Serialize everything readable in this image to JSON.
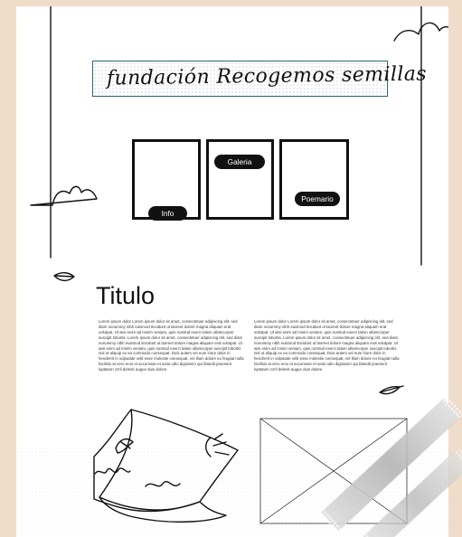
{
  "header": {
    "title": "fundación Recogemos semillas"
  },
  "nav": {
    "info_label": "Info",
    "gallery_label": "Galeria",
    "poem_label": "Poemario"
  },
  "content": {
    "section_title": "Titulo",
    "paragraph_left": "Lorem ipsum dolor Lorem ipsum dolor sit amet, consectetuer adipiscing elit, sed diam nonummy nibh euismod tincidunt ut laoreet dolore magna aliquam erat volutpat. Ut wisi enim ad minim veniam, quis nostrud exerci tation ullamcorper suscipit lobortis. Lorem ipsum dolor sit amet, consectetuer adipiscing elit, sed diam nonummy nibh euismod tincidunt ut laoreet dolore magna aliquam erat volutpat. Ut wisi enim ad minim veniam, quis nostrud exerci tation ullamcorper suscipit lobortis nisl ut aliquip ex ea commodo consequat. Duis autem vel eum iriure dolor in hendrerit in vulputate velit esse molestie consequat, vel illum dolore eu feugiat nulla facilisis at vero eros et accumsan et iusto odio dignissim qui blandit praesent luptatum zzril delenit augue duis dolore",
    "paragraph_right": "Lorem ipsum dolor Lorem ipsum dolor sit amet, consectetuer adipiscing elit, sed diam nonummy nibh euismod tincidunt ut laoreet dolore magna aliquam erat volutpat. Ut wisi enim ad minim veniam, quis nostrud exerci tation ullamcorper suscipit lobortis. Lorem ipsum dolor sit amet, consectetuer adipiscing elit, sed diam nonummy nibh euismod tincidunt ut laoreet dolore magna aliquam erat volutpat. Ut wisi enim ad minim veniam, quis nostrud exerci tation ullamcorper suscipit lobortis nisl ut aliquip ex ea commodo consequat. Duis autem vel eum iriure dolor in hendrerit in vulputate velit esse molestie consequat, vel illum dolore eu feugiat nulla facilisis at vero eros et accumsan et iusto odio dignissim qui blandit praesent luptatum zzril delenit augue duis dolore"
  },
  "icons": {
    "hand": "hand-icon",
    "leaf": "leaf-icon",
    "cloud": "cloud-icon",
    "book": "book-sketch-icon",
    "image_placeholder": "image-placeholder-icon"
  },
  "colors": {
    "background": "#efdcc9",
    "paper": "#ffffff",
    "ink": "#111111",
    "title_border": "#2f6672"
  }
}
